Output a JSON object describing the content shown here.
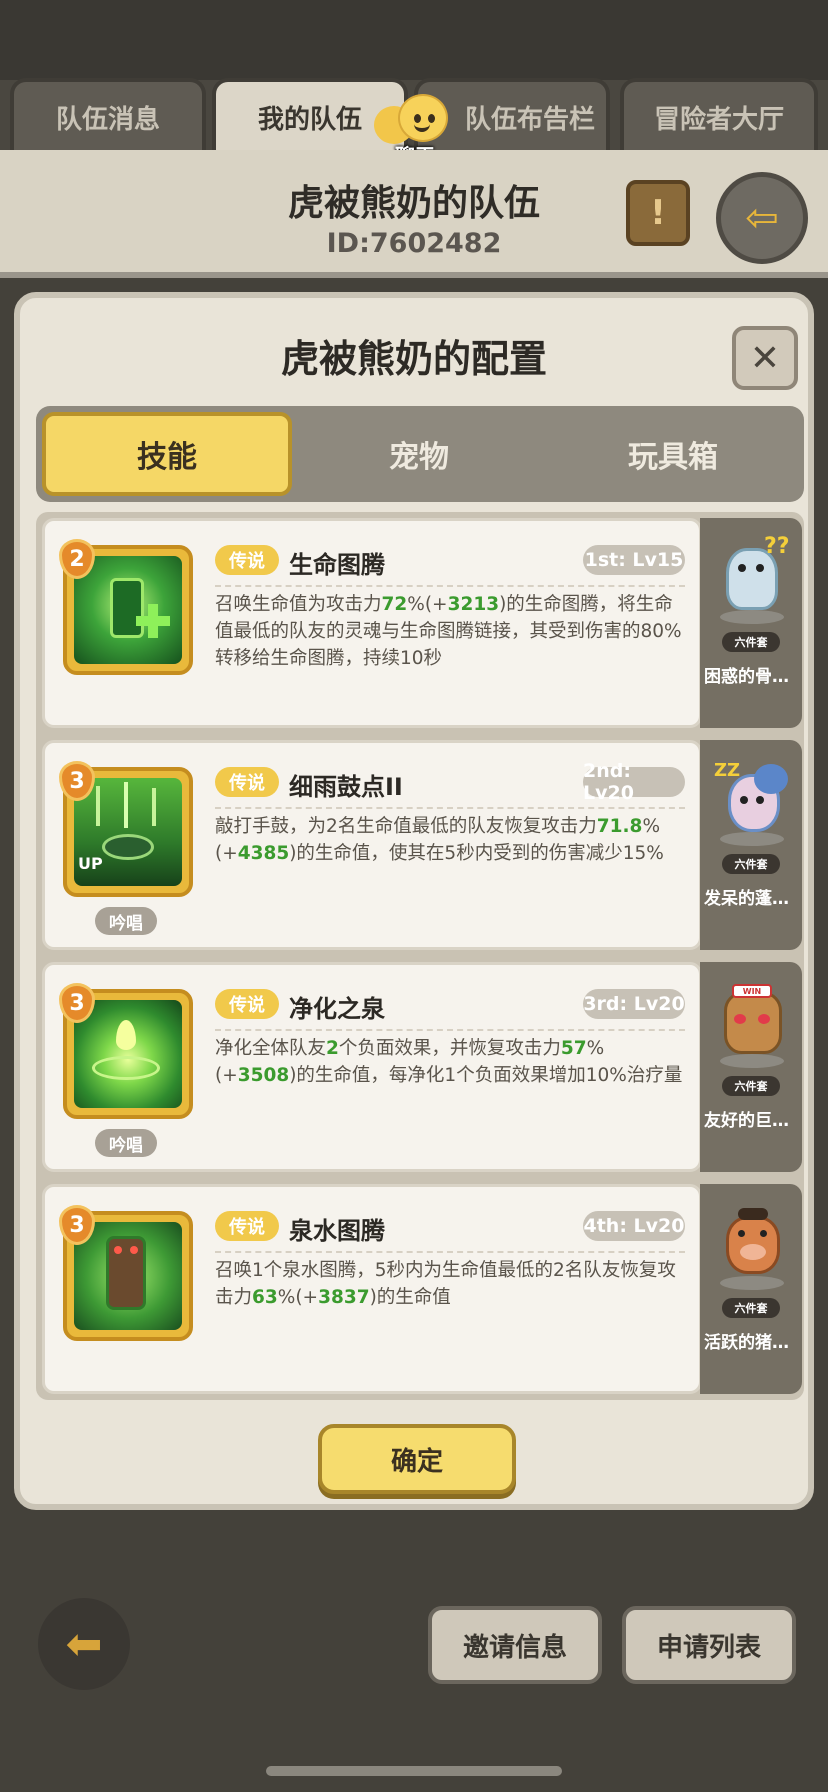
{
  "tabs": [
    {
      "label": "队伍消息",
      "active": false
    },
    {
      "label": "我的队伍",
      "active": true
    },
    {
      "label": "队伍布告栏",
      "active": false
    },
    {
      "label": "冒险者大厅",
      "active": false
    }
  ],
  "chat": {
    "label": "聊天"
  },
  "team": {
    "name": "虎被熊奶的队伍",
    "id": "ID:7602482"
  },
  "modal": {
    "title": "虎被熊奶的配置",
    "segments": [
      {
        "label": "技能",
        "active": true
      },
      {
        "label": "宠物",
        "active": false
      },
      {
        "label": "玩具箱",
        "active": false
      }
    ],
    "confirm_label": "确定"
  },
  "skills": [
    {
      "level_badge": "2",
      "rarity": "传说",
      "name": "生命图腾",
      "slot_level": "1st: Lv15",
      "chant": "",
      "desc_html": "召唤生命值为攻击力<span class='g'>72</span>%(+<span class='g'>3213</span>)的生命图腾，将生命值最低的队友的灵魂与生命图腾链接，其受到伤害的80%转移给生命图腾，持续10秒"
    },
    {
      "level_badge": "3",
      "rarity": "传说",
      "name": "细雨鼓点II",
      "slot_level": "2nd: Lv20",
      "chant": "吟唱",
      "desc_html": "敲打手鼓，为2名生命值最低的队友恢复攻击力<span class='g'>71.8</span>%(+<span class='g'>4385</span>)的生命值，使其在5秒内受到的伤害减少15%"
    },
    {
      "level_badge": "3",
      "rarity": "传说",
      "name": "净化之泉",
      "slot_level": "3rd: Lv20",
      "chant": "吟唱",
      "desc_html": "净化全体队友<span class='g'>2</span>个负面效果，并恢复攻击力<span class='g'>57</span>%(+<span class='g'>3508</span>)的生命值，每净化1个负面效果增加10%治疗量"
    },
    {
      "level_badge": "3",
      "rarity": "传说",
      "name": "泉水图腾",
      "slot_level": "4th: Lv20",
      "chant": "",
      "desc_html": "召唤1个泉水图腾，5秒内为生命值最低的2名队友恢复攻击力<span class='g'>63</span>%(+<span class='g'>3837</span>)的生命值"
    }
  ],
  "pets": [
    {
      "set_label": "六件套",
      "name": "困惑的骨…"
    },
    {
      "set_label": "六件套",
      "name": "发呆的蓬…"
    },
    {
      "set_label": "六件套",
      "name": "友好的巨…"
    },
    {
      "set_label": "六件套",
      "name": "活跃的猪…"
    }
  ],
  "bottom": {
    "invite_label": "邀请信息",
    "apply_label": "申请列表"
  }
}
